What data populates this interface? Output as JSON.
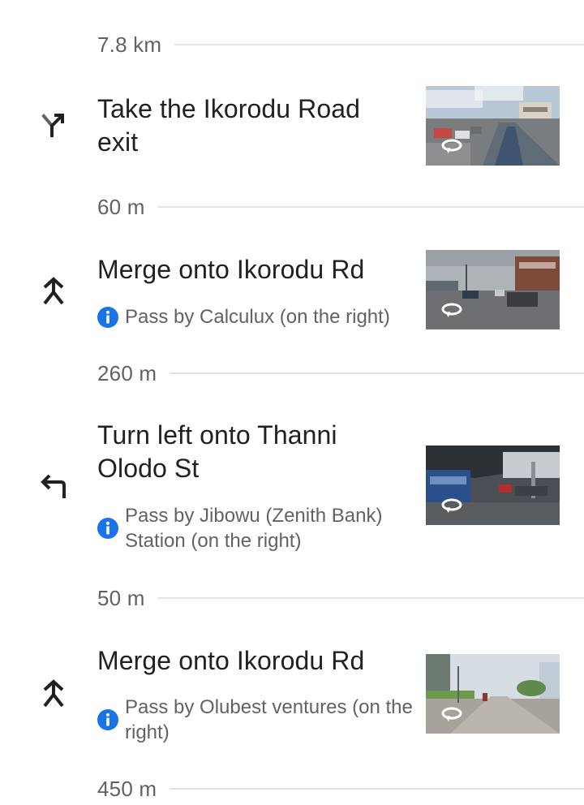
{
  "distances": [
    "7.8 km",
    "60 m",
    "260 m",
    "50 m",
    "450 m"
  ],
  "steps": [
    {
      "icon": "exit-right-icon",
      "title": "Take the Ikorodu Road exit",
      "info": ""
    },
    {
      "icon": "merge-icon",
      "title": "Merge onto Ikorodu Rd",
      "info": "Pass by Calculux (on the right)"
    },
    {
      "icon": "turn-left-icon",
      "title": "Turn left onto Thanni Olodo St",
      "info": "Pass by Jibowu (Zenith Bank) Station (on the right)"
    },
    {
      "icon": "merge-icon",
      "title": "Merge onto Ikorodu Rd",
      "info": "Pass by Olubest ventures (on the right)"
    }
  ],
  "colors": {
    "info_blue": "#1a73e8",
    "text_primary": "#202124",
    "text_secondary": "#5f6368",
    "divider": "#e3e3e3"
  },
  "thumbnail_icon": "street-view-rotate-icon"
}
